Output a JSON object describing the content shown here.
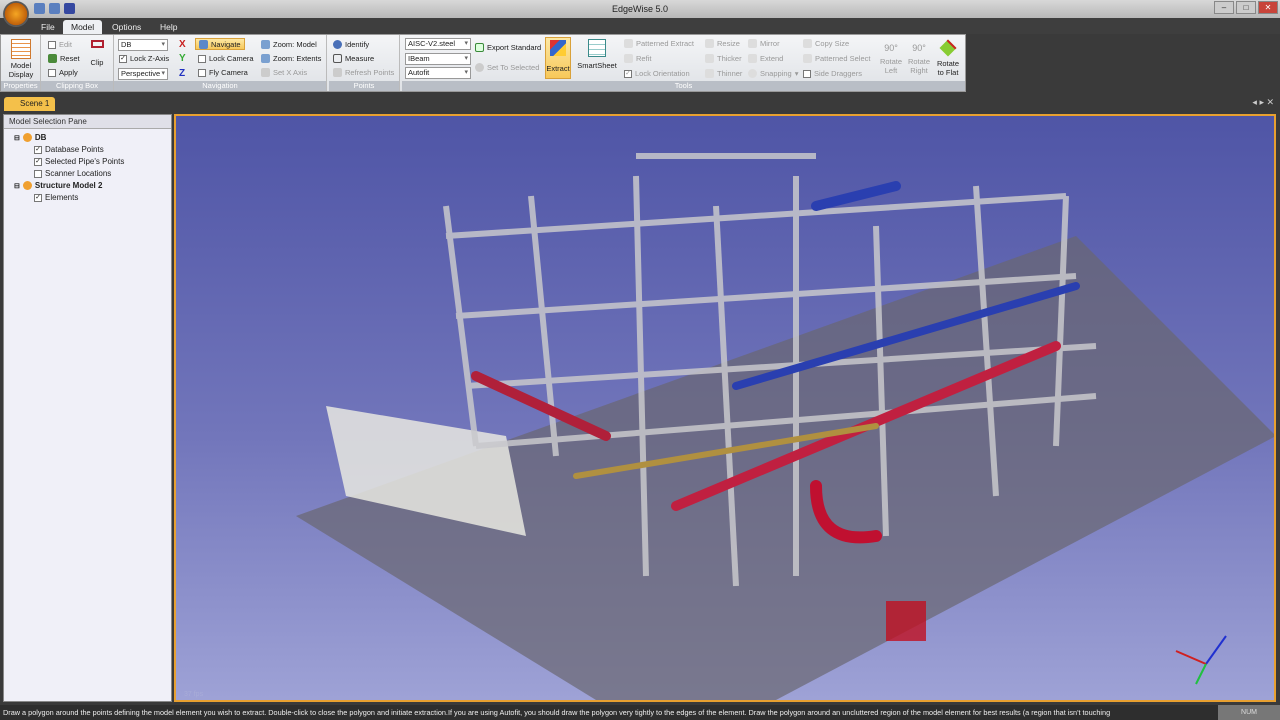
{
  "window": {
    "title": "EdgeWise 5.0"
  },
  "menu_tabs": [
    "File",
    "Model",
    "Options",
    "Help"
  ],
  "ribbon": {
    "properties": {
      "label": "Properties",
      "model_display": "Model Display"
    },
    "clipping_box": {
      "label": "Clipping Box",
      "edit": "Edit",
      "reset": "Reset",
      "apply": "Apply",
      "clip": "Clip"
    },
    "navigation": {
      "label": "Navigation",
      "db_select": "DB",
      "lock_z_axis": "Lock Z-Axis",
      "projection": "Perspective",
      "x": "X",
      "y": "Y",
      "z": "Z",
      "navigate": "Navigate",
      "lock_camera": "Lock Camera",
      "fly_camera": "Fly Camera",
      "zoom_model": "Zoom: Model",
      "zoom_extents": "Zoom: Extents",
      "set_x_axis": "Set X Axis"
    },
    "points": {
      "label": "Points",
      "identify": "Identify",
      "measure": "Measure",
      "refresh_points": "Refresh Points"
    },
    "tools": {
      "label": "Tools",
      "standard": "AISC-V2.steel",
      "shape": "IBeam",
      "fit": "Autofit",
      "export_standard": "Export Standard",
      "set_to_selected": "Set To Selected",
      "extract": "Extract",
      "smartsheet": "SmartSheet",
      "patterned_extract": "Patterned Extract",
      "refit": "Refit",
      "lock_orientation": "Lock Orientation",
      "resize": "Resize",
      "thicker": "Thicker",
      "thinner": "Thinner",
      "mirror": "Mirror",
      "extend": "Extend",
      "snapping": "Snapping",
      "copy_size": "Copy Size",
      "patterned_select": "Patterned Select",
      "side_draggers": "Side Draggers",
      "rotate_left": "Rotate Left",
      "rotate_right": "Rotate Right",
      "rotate_to_flat": "Rotate to Flat",
      "deg": "90°"
    }
  },
  "scene_tab": "Scene 1",
  "pane": {
    "title": "Model Selection Pane",
    "nodes": [
      {
        "label": "DB",
        "checked": null
      },
      {
        "label": "Database Points",
        "checked": true
      },
      {
        "label": "Selected Pipe's Points",
        "checked": true
      },
      {
        "label": "Scanner Locations",
        "checked": false
      },
      {
        "label": "Structure Model 2",
        "checked": null
      },
      {
        "label": "Elements",
        "checked": true
      }
    ]
  },
  "viewport": {
    "fps": "37 fps"
  },
  "status": {
    "message": "Draw a polygon around the points defining the model element you wish to extract.  Double-click to close the polygon and initiate extraction.If you are using Autofit, you should draw the polygon very tightly to the edges of the element.  Draw the polygon around an uncluttered region of the model element for best results (a region that isn't touching",
    "num": "NUM"
  }
}
